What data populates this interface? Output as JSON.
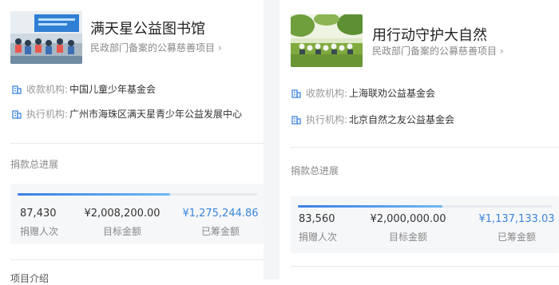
{
  "left_card": {
    "title": "满天星公益图书馆",
    "subtitle": "民政部门备案的公募慈善项目",
    "receiver_label": "收款机构:",
    "receiver_value": "中国儿童少年基金会",
    "executor_label": "执行机构:",
    "executor_value": "广州市海珠区满天星青少年公益发展中心",
    "progress_label": "捐款总进展",
    "progress_fraction": 0.635,
    "donors_value": "87,430",
    "donors_caption": "捐赠人次",
    "target_value": "¥2,008,200.00",
    "target_caption": "目标金额",
    "raised_value": "¥1,275,244.86",
    "raised_caption": "已筹金额",
    "next_section": "项目介绍"
  },
  "right_card": {
    "title": "用行动守护大自然",
    "subtitle": "民政部门备案的公募慈善项目",
    "receiver_label": "收款机构:",
    "receiver_value": "上海联劝公益基金会",
    "executor_label": "执行机构:",
    "executor_value": "北京自然之友公益基金会",
    "progress_label": "捐款总进展",
    "progress_fraction": 0.569,
    "donors_value": "83,560",
    "donors_caption": "捐赠人次",
    "target_value": "¥2,000,000.00",
    "target_caption": "目标金额",
    "raised_value": "¥1,137,133.03",
    "raised_caption": "已筹金额"
  },
  "colors": {
    "accent_blue": "#3a86d8",
    "progress_gradient_start": "#3b7fe6",
    "progress_gradient_end": "#6fb8f0"
  },
  "icons": {
    "subtitle_arrow": "chevron-right-icon",
    "org_icon": "building-icon"
  }
}
